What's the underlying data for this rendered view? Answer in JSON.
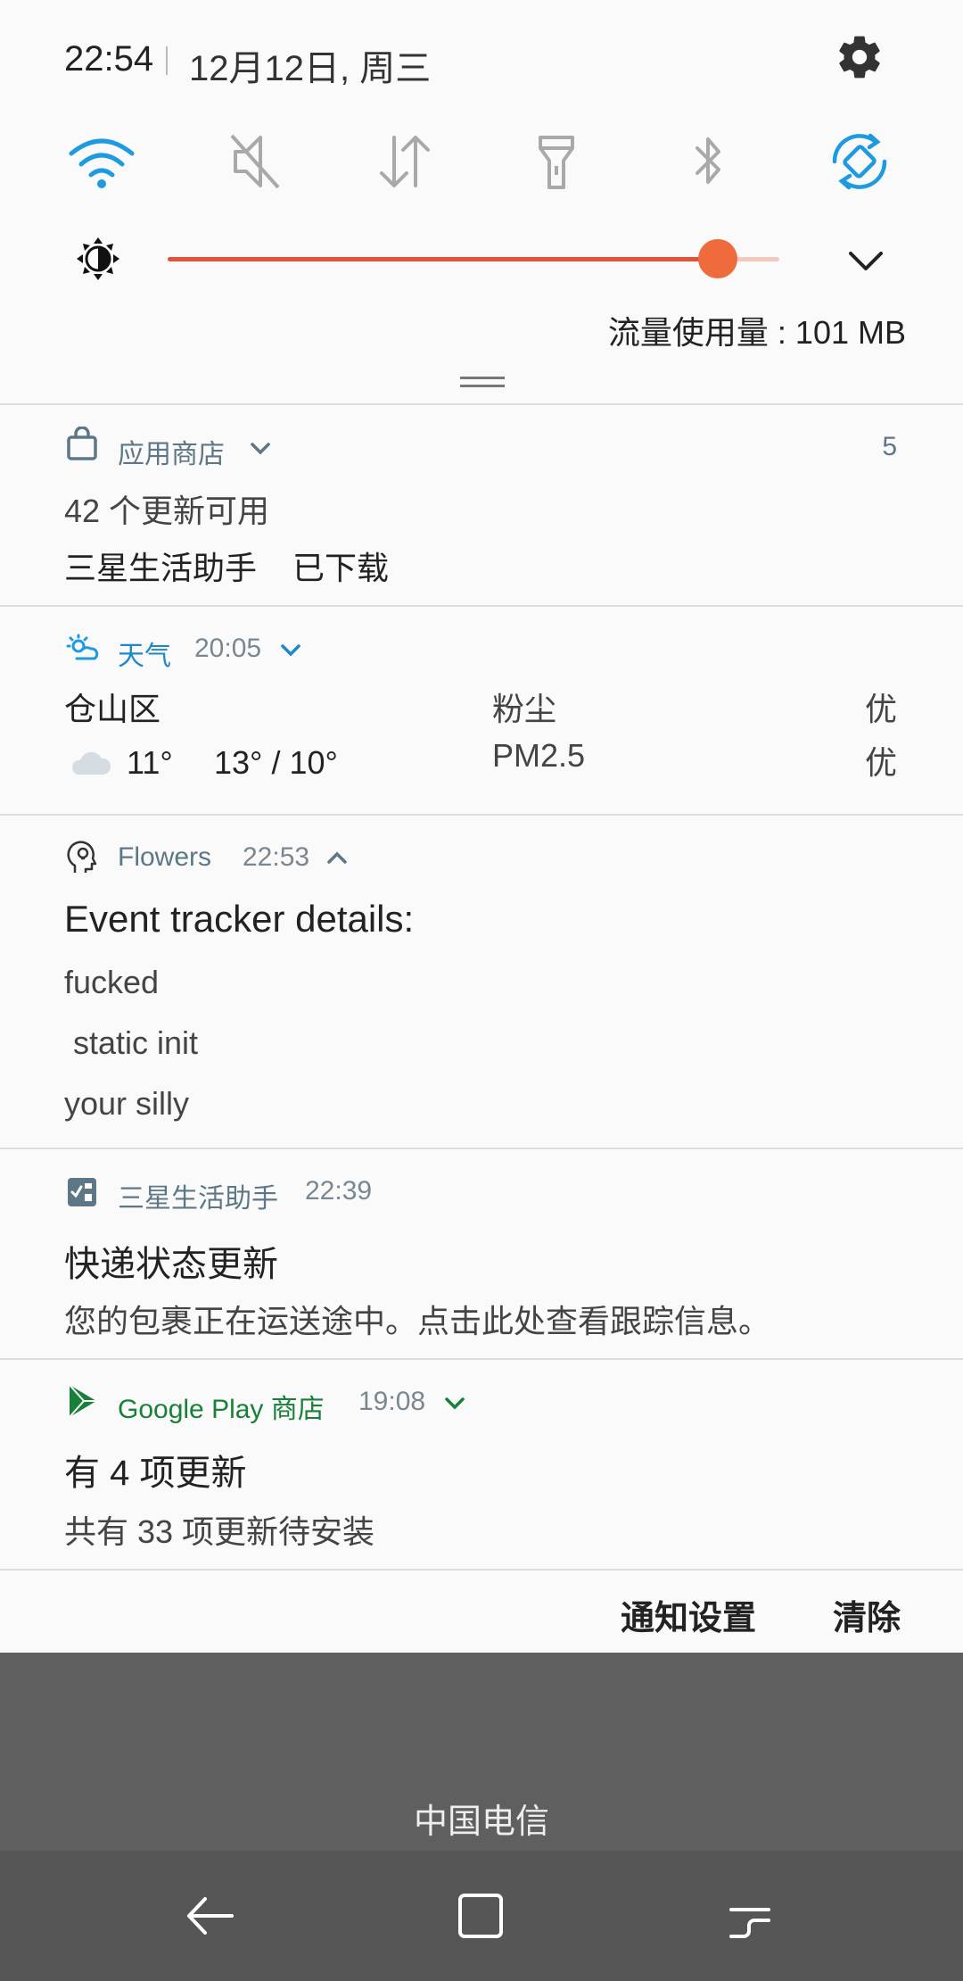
{
  "status": {
    "time": "22:54",
    "date": "12月12日, 周三"
  },
  "quick_settings": [
    "wifi-icon",
    "sound-off-icon",
    "mobile-data-icon",
    "flashlight-icon",
    "bluetooth-icon",
    "auto-rotate-icon"
  ],
  "brightness": {
    "level": 0.9
  },
  "data_usage": "流量使用量 : 101 MB",
  "notifications": {
    "app_store": {
      "app": "应用商店",
      "count": "5",
      "line1": "42 个更新可用",
      "line2": "三星生活助手    已下载"
    },
    "weather": {
      "app": "天气",
      "time": "20:05",
      "location": "仓山区",
      "temp": "11°",
      "range": "13° / 10°",
      "dust_label": "粉尘",
      "pm_label": "PM2.5",
      "dust_value": "优",
      "pm_value": "优"
    },
    "flowers": {
      "app": "Flowers",
      "time": "22:53",
      "title": "Event tracker details:",
      "lines": [
        "fucked",
        " static init",
        "your silly"
      ]
    },
    "samsung": {
      "app": "三星生活助手",
      "time": "22:39",
      "title": "快递状态更新",
      "body": "您的包裹正在运送途中。点击此处查看跟踪信息。"
    },
    "google_play": {
      "app": "Google Play 商店",
      "time": "19:08",
      "title": "有 4 项更新",
      "body": "共有 33 项更新待安装"
    }
  },
  "footer": {
    "settings": "通知设置",
    "clear": "清除"
  },
  "carrier": "中国电信",
  "colors": {
    "accent_blue": "#1e9be0",
    "brightness_red": "#e3533c",
    "play_green": "#188038"
  }
}
